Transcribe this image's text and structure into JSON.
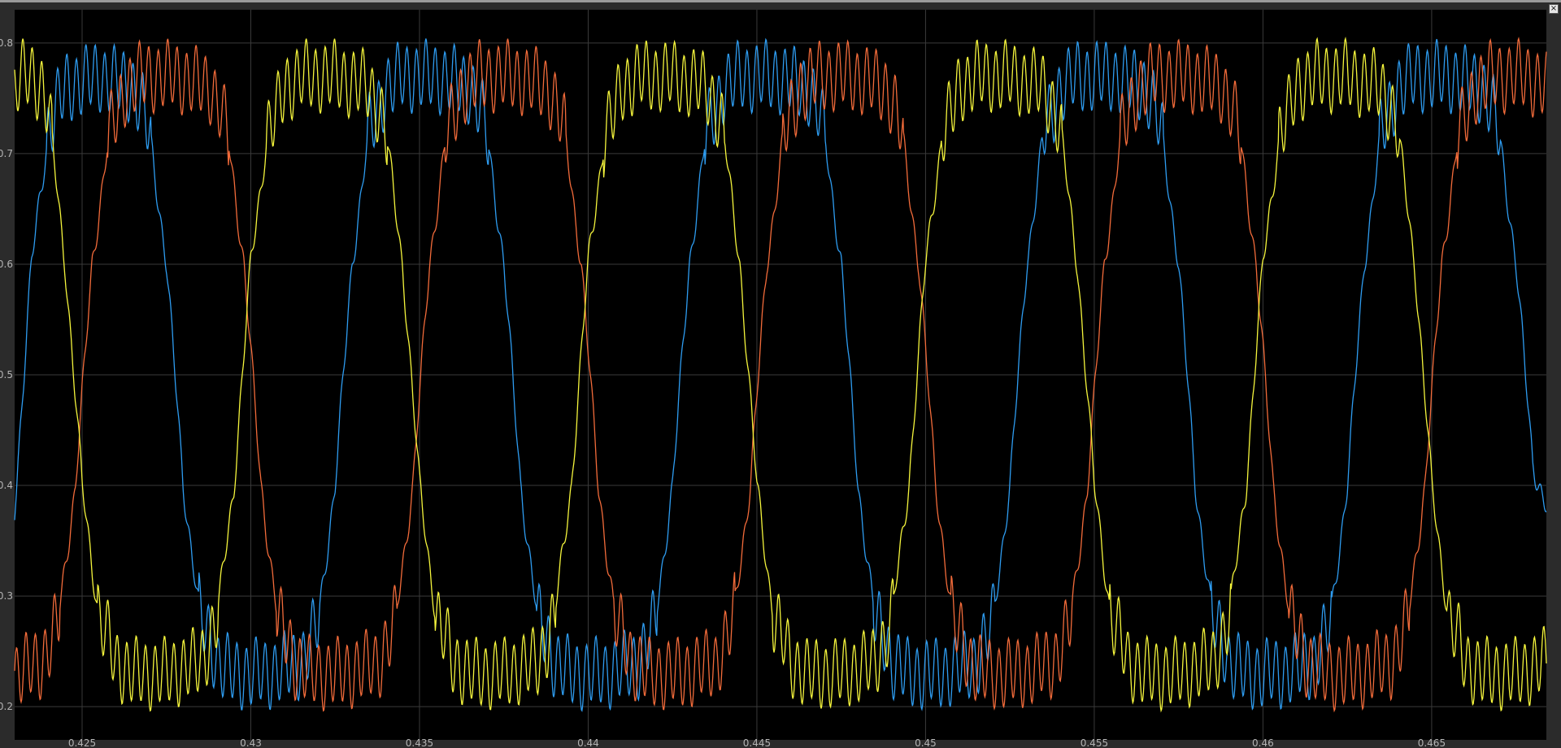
{
  "window": {
    "close_glyph": "×"
  },
  "colors": {
    "background": "#000000",
    "frame": "#2b2b2b",
    "grid": "#3a3a3a",
    "tick_label": "#b4b4b4",
    "series_blue": "#2e9cf0",
    "series_orange": "#f26b3a",
    "series_yellow": "#f5f53c"
  },
  "chart_data": {
    "type": "line",
    "title": "",
    "xlabel": "",
    "ylabel": "",
    "xlim": [
      0.423,
      0.4684
    ],
    "ylim": [
      0.17,
      0.83
    ],
    "grid": true,
    "legend": "none",
    "xticks": [
      0.425,
      0.43,
      0.435,
      0.44,
      0.445,
      0.45,
      0.455,
      0.46,
      0.465
    ],
    "xtick_labels": [
      "0.425",
      "0.43",
      "0.435",
      "0.44",
      "0.445",
      "0.45",
      "0.455",
      "0.46",
      "0.465"
    ],
    "yticks": [
      0.2,
      0.3,
      0.4,
      0.5,
      0.6,
      0.7,
      0.8
    ],
    "ytick_labels": [
      "0.2",
      "0.3",
      "0.4",
      "0.5",
      "0.6",
      "0.7",
      "0.8"
    ],
    "fundamental_period": 0.005,
    "series": [
      {
        "color": "#2e9cf0",
        "x": [
          0.423,
          0.4235,
          0.424,
          0.4242,
          0.4245,
          0.4255,
          0.4265,
          0.4268,
          0.427,
          0.4275,
          0.428,
          0.4285,
          0.4288,
          0.429,
          0.4295,
          0.4305,
          0.4315,
          0.4318,
          0.432,
          0.4325,
          0.433,
          0.4335,
          0.4338,
          0.434,
          0.4345,
          0.4355,
          0.4365,
          0.4368,
          0.437,
          0.4375,
          0.438,
          0.4385,
          0.4388,
          0.439,
          0.4395,
          0.4405,
          0.4415,
          0.4418,
          0.442,
          0.4425,
          0.443,
          0.4435,
          0.4438,
          0.444,
          0.4445,
          0.4455,
          0.4465,
          0.4468,
          0.447,
          0.4475,
          0.448,
          0.4485,
          0.4488,
          0.449,
          0.4495,
          0.4505,
          0.4515,
          0.4518,
          0.452,
          0.4525,
          0.453,
          0.4535,
          0.4538,
          0.454,
          0.4545,
          0.4555,
          0.4565,
          0.4568,
          0.457,
          0.4575,
          0.458,
          0.4585,
          0.4588,
          0.459,
          0.4595,
          0.4605,
          0.4615,
          0.4618,
          0.462,
          0.4625,
          0.463,
          0.4635,
          0.4638,
          0.464,
          0.4645,
          0.4655,
          0.4665,
          0.4668,
          0.467,
          0.4675,
          0.468,
          0.4684
        ],
        "y": [
          0.38,
          0.6,
          0.72,
          0.74,
          0.76,
          0.77,
          0.76,
          0.74,
          0.72,
          0.6,
          0.4,
          0.28,
          0.26,
          0.24,
          0.23,
          0.23,
          0.24,
          0.26,
          0.28,
          0.4,
          0.6,
          0.72,
          0.74,
          0.76,
          0.77,
          0.77,
          0.76,
          0.74,
          0.72,
          0.6,
          0.4,
          0.28,
          0.26,
          0.24,
          0.23,
          0.23,
          0.24,
          0.26,
          0.28,
          0.4,
          0.6,
          0.72,
          0.74,
          0.76,
          0.77,
          0.77,
          0.76,
          0.74,
          0.72,
          0.6,
          0.4,
          0.28,
          0.26,
          0.24,
          0.23,
          0.23,
          0.24,
          0.26,
          0.28,
          0.4,
          0.6,
          0.72,
          0.74,
          0.76,
          0.77,
          0.77,
          0.76,
          0.74,
          0.72,
          0.6,
          0.4,
          0.28,
          0.26,
          0.24,
          0.23,
          0.23,
          0.24,
          0.26,
          0.28,
          0.4,
          0.6,
          0.72,
          0.74,
          0.76,
          0.77,
          0.77,
          0.76,
          0.74,
          0.72,
          0.6,
          0.42,
          0.38
        ]
      },
      {
        "color": "#f26b3a",
        "x": [
          0.423,
          0.4238,
          0.4241,
          0.4243,
          0.4248,
          0.4253,
          0.4258,
          0.4261,
          0.4263,
          0.4268,
          0.4278,
          0.4288,
          0.4291,
          0.4293,
          0.4298,
          0.4303,
          0.4308,
          0.4311,
          0.4313,
          0.4318,
          0.4328,
          0.4338,
          0.4341,
          0.4343,
          0.4348,
          0.4353,
          0.4358,
          0.4361,
          0.4363,
          0.4368,
          0.4378,
          0.4388,
          0.4391,
          0.4393,
          0.4398,
          0.4403,
          0.4408,
          0.4411,
          0.4413,
          0.4418,
          0.4428,
          0.4438,
          0.4441,
          0.4443,
          0.4448,
          0.4453,
          0.4458,
          0.4461,
          0.4463,
          0.4468,
          0.4478,
          0.4488,
          0.4491,
          0.4493,
          0.4498,
          0.4503,
          0.4508,
          0.4511,
          0.4513,
          0.4518,
          0.4528,
          0.4538,
          0.4541,
          0.4543,
          0.4548,
          0.4553,
          0.4558,
          0.4561,
          0.4563,
          0.4568,
          0.4578,
          0.4588,
          0.4591,
          0.4593,
          0.4598,
          0.4603,
          0.4608,
          0.4611,
          0.4613,
          0.4618,
          0.4628,
          0.4638,
          0.4641,
          0.4643,
          0.4648,
          0.4653,
          0.4658,
          0.4661,
          0.4663,
          0.4668,
          0.4678,
          0.4684
        ],
        "y": [
          0.23,
          0.24,
          0.26,
          0.28,
          0.4,
          0.6,
          0.72,
          0.74,
          0.76,
          0.77,
          0.77,
          0.76,
          0.74,
          0.72,
          0.6,
          0.4,
          0.28,
          0.26,
          0.24,
          0.23,
          0.23,
          0.24,
          0.26,
          0.28,
          0.4,
          0.6,
          0.72,
          0.74,
          0.76,
          0.77,
          0.77,
          0.76,
          0.74,
          0.72,
          0.6,
          0.4,
          0.28,
          0.26,
          0.24,
          0.23,
          0.23,
          0.24,
          0.26,
          0.28,
          0.4,
          0.6,
          0.72,
          0.74,
          0.76,
          0.77,
          0.77,
          0.76,
          0.74,
          0.72,
          0.6,
          0.4,
          0.28,
          0.26,
          0.24,
          0.23,
          0.23,
          0.24,
          0.26,
          0.28,
          0.4,
          0.6,
          0.72,
          0.74,
          0.76,
          0.77,
          0.77,
          0.76,
          0.74,
          0.72,
          0.6,
          0.4,
          0.28,
          0.26,
          0.24,
          0.23,
          0.23,
          0.24,
          0.26,
          0.28,
          0.4,
          0.6,
          0.72,
          0.74,
          0.76,
          0.77,
          0.77,
          0.76
        ]
      },
      {
        "color": "#f5f53c",
        "x": [
          0.423,
          0.4232,
          0.4235,
          0.4238,
          0.424,
          0.4245,
          0.425,
          0.4255,
          0.4258,
          0.426,
          0.4265,
          0.4275,
          0.4285,
          0.4288,
          0.429,
          0.4295,
          0.43,
          0.4305,
          0.4308,
          0.431,
          0.4315,
          0.4325,
          0.4335,
          0.4338,
          0.434,
          0.4345,
          0.435,
          0.4355,
          0.4358,
          0.436,
          0.4365,
          0.4375,
          0.4385,
          0.4388,
          0.439,
          0.4395,
          0.44,
          0.4405,
          0.4408,
          0.441,
          0.4415,
          0.4425,
          0.4435,
          0.4438,
          0.444,
          0.4445,
          0.445,
          0.4455,
          0.4458,
          0.446,
          0.4465,
          0.4475,
          0.4485,
          0.4488,
          0.449,
          0.4495,
          0.45,
          0.4505,
          0.4508,
          0.451,
          0.4515,
          0.4525,
          0.4535,
          0.4538,
          0.454,
          0.4545,
          0.455,
          0.4555,
          0.4558,
          0.456,
          0.4565,
          0.4575,
          0.4585,
          0.4588,
          0.459,
          0.4595,
          0.46,
          0.4605,
          0.4608,
          0.461,
          0.4615,
          0.4625,
          0.4635,
          0.4638,
          0.464,
          0.4645,
          0.465,
          0.4655,
          0.4658,
          0.466,
          0.4665,
          0.4675,
          0.4684
        ],
        "y": [
          0.76,
          0.77,
          0.77,
          0.76,
          0.74,
          0.6,
          0.4,
          0.28,
          0.26,
          0.24,
          0.23,
          0.23,
          0.24,
          0.26,
          0.28,
          0.4,
          0.6,
          0.72,
          0.74,
          0.76,
          0.77,
          0.77,
          0.76,
          0.74,
          0.72,
          0.6,
          0.4,
          0.28,
          0.26,
          0.24,
          0.23,
          0.23,
          0.24,
          0.26,
          0.28,
          0.4,
          0.6,
          0.72,
          0.74,
          0.76,
          0.77,
          0.77,
          0.76,
          0.74,
          0.72,
          0.6,
          0.4,
          0.28,
          0.26,
          0.24,
          0.23,
          0.23,
          0.24,
          0.26,
          0.28,
          0.4,
          0.6,
          0.72,
          0.74,
          0.76,
          0.77,
          0.77,
          0.76,
          0.74,
          0.72,
          0.6,
          0.4,
          0.28,
          0.26,
          0.24,
          0.23,
          0.23,
          0.24,
          0.26,
          0.28,
          0.4,
          0.6,
          0.72,
          0.74,
          0.76,
          0.77,
          0.77,
          0.76,
          0.74,
          0.72,
          0.6,
          0.4,
          0.28,
          0.26,
          0.24,
          0.23,
          0.23,
          0.24
        ]
      }
    ]
  }
}
